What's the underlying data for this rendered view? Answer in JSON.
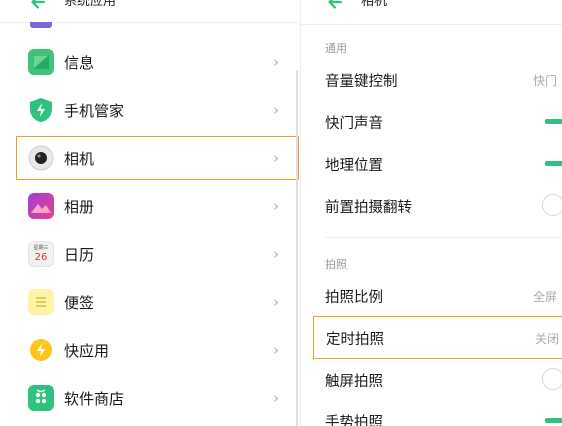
{
  "left": {
    "title": "系统应用",
    "apps": [
      {
        "label": "信息",
        "icon": "message-icon"
      },
      {
        "label": "手机管家",
        "icon": "shield-icon"
      },
      {
        "label": "相机",
        "icon": "camera-icon"
      },
      {
        "label": "相册",
        "icon": "photos-icon"
      },
      {
        "label": "日历",
        "icon": "calendar-icon",
        "icon_text_top": "星期三",
        "icon_text_num": "26"
      },
      {
        "label": "便签",
        "icon": "notes-icon"
      },
      {
        "label": "快应用",
        "icon": "quick-app-icon"
      },
      {
        "label": "软件商店",
        "icon": "app-store-icon"
      }
    ],
    "selected_index": 2
  },
  "right": {
    "title": "相机",
    "section_general": "通用",
    "section_photo": "拍照",
    "items": [
      {
        "label": "音量键控制",
        "value": "快门"
      },
      {
        "label": "快门声音",
        "toggle": "on"
      },
      {
        "label": "地理位置",
        "toggle": "on"
      },
      {
        "label": "前置拍摄翻转",
        "toggle": "off"
      },
      {
        "label": "拍照比例",
        "value": "全屏"
      },
      {
        "label": "定时拍照",
        "value": "关闭"
      },
      {
        "label": "触屏拍照",
        "toggle": "off"
      },
      {
        "label": "手势拍照",
        "toggle": "on"
      }
    ]
  },
  "colors": {
    "accent_green": "#2ec27e",
    "selection_border": "#f0a020"
  }
}
